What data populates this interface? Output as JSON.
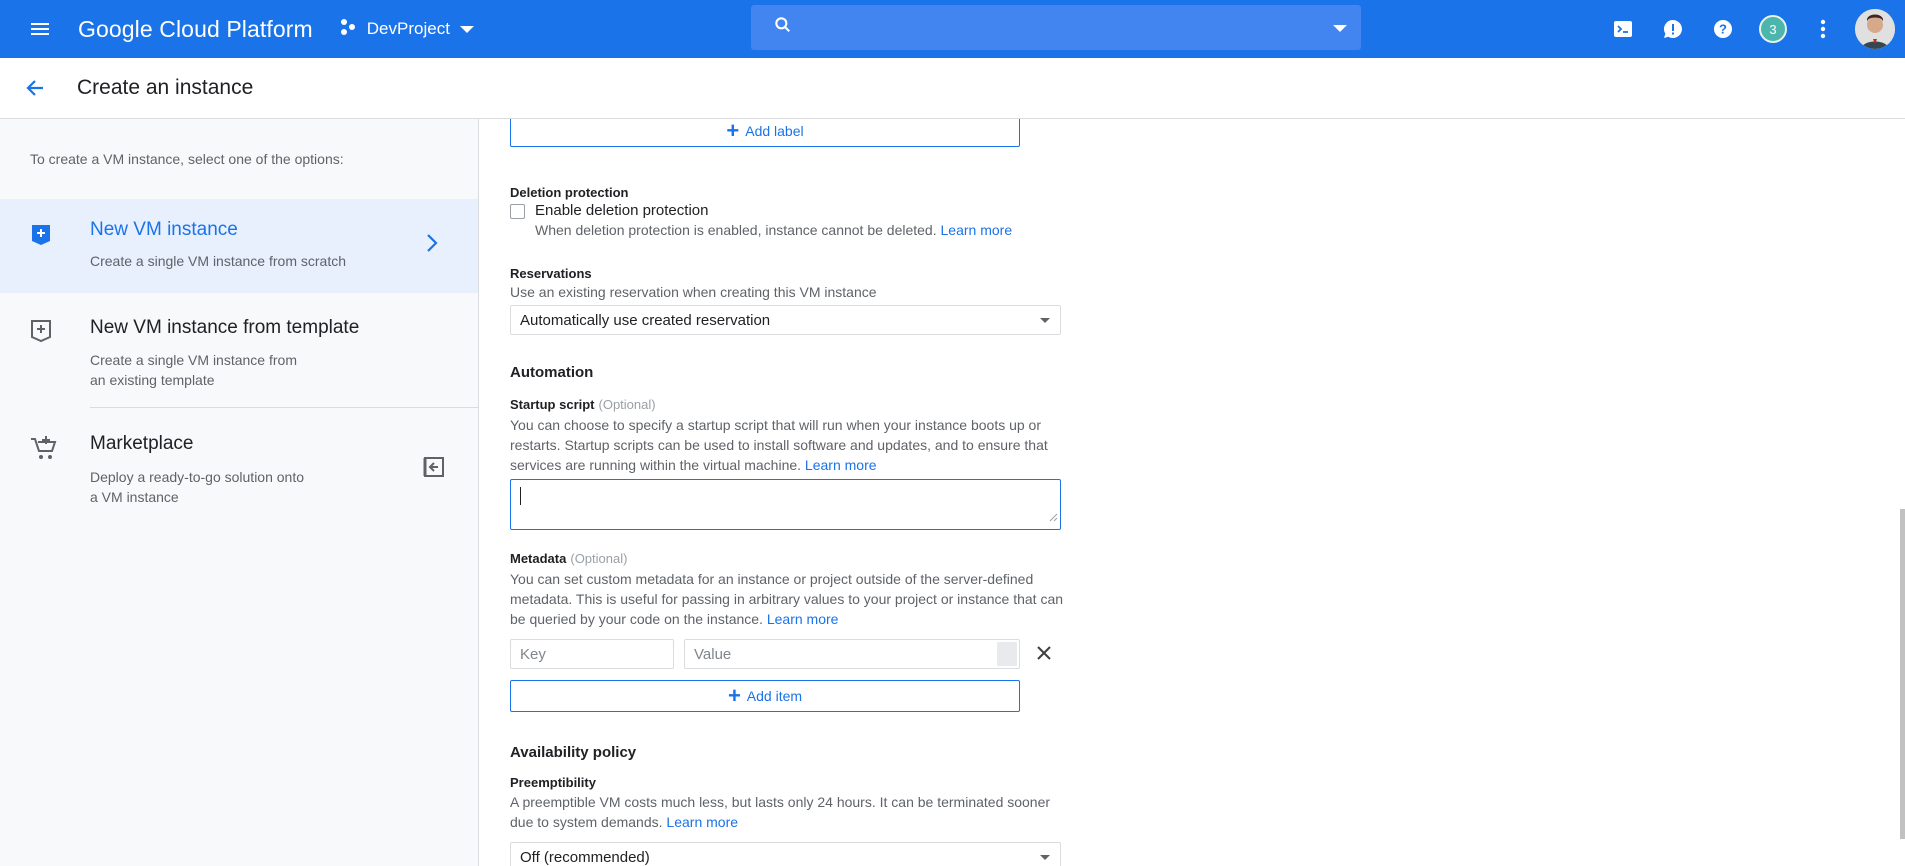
{
  "topbar": {
    "app_title": "Google Cloud Platform",
    "project_name": "DevProject",
    "search_placeholder": "",
    "notification_count": "3"
  },
  "subheader": {
    "title": "Create an instance"
  },
  "left": {
    "intro": "To create a VM instance, select one of the options:",
    "options": [
      {
        "title": "New VM instance",
        "desc": "Create a single VM instance from scratch"
      },
      {
        "title": "New VM instance from template",
        "desc_line1": "Create a single VM instance from",
        "desc_line2": "an existing template"
      },
      {
        "title": "Marketplace",
        "desc_line1": "Deploy a ready-to-go solution onto",
        "desc_line2": "a VM instance"
      }
    ]
  },
  "form": {
    "add_label": "Add label",
    "deletion": {
      "title": "Deletion protection",
      "checkbox_label": "Enable deletion protection",
      "help": "When deletion protection is enabled, instance cannot be deleted.",
      "learn_more": "Learn more"
    },
    "reservations": {
      "title": "Reservations",
      "help": "Use an existing reservation when creating this VM instance",
      "selected": "Automatically use created reservation"
    },
    "automation": {
      "title": "Automation",
      "startup_label": "Startup script",
      "optional": "(Optional)",
      "startup_help_line1": "You can choose to specify a startup script that will run when your instance boots up or",
      "startup_help_line2": "restarts. Startup scripts can be used to install software and updates, and to ensure that",
      "startup_help_line3": "services are running within the virtual machine.",
      "learn_more": "Learn more"
    },
    "metadata": {
      "label": "Metadata",
      "optional": "(Optional)",
      "help_line1": "You can set custom metadata for an instance or project outside of the server-defined",
      "help_line2": "metadata. This is useful for passing in arbitrary values to your project or instance that can",
      "help_line3": "be queried by your code on the instance.",
      "learn_more": "Learn more",
      "key_placeholder": "Key",
      "value_placeholder": "Value",
      "add_item": "Add item"
    },
    "availability": {
      "title": "Availability policy",
      "preempt_label": "Preemptibility",
      "help_line1": "A preemptible VM costs much less, but lasts only 24 hours. It can be terminated sooner",
      "help_line2": "due to system demands.",
      "learn_more": "Learn more",
      "selected": "Off (recommended)"
    }
  },
  "colors": {
    "brand": "#1a73e8",
    "panel": "#f8f9fa",
    "active": "#e8f0fe"
  }
}
